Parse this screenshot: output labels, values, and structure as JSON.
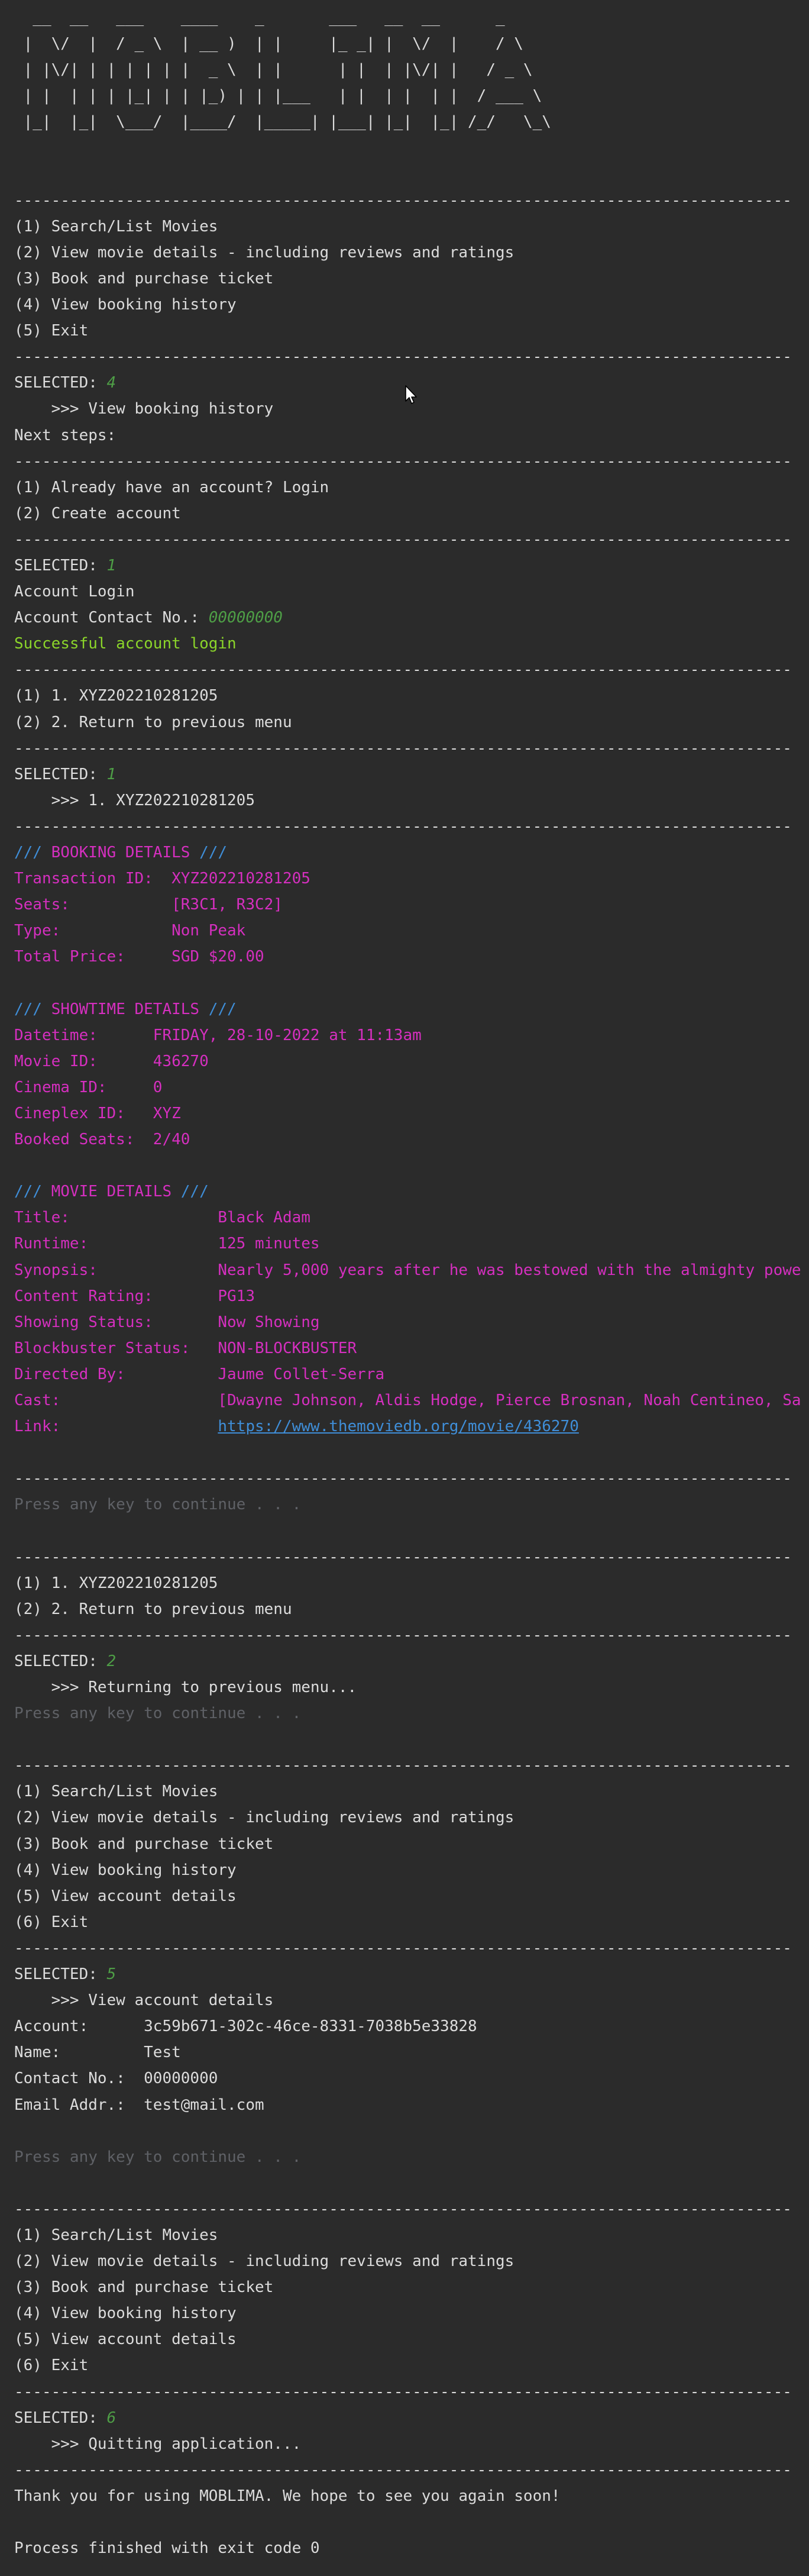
{
  "app": {
    "name": "MOBLIMA",
    "banner": [
      "  __  __   ___    ____    _       ___   __  __      _",
      " |  \\/  |  / _ \\  | __ )  | |     |_ _| |  \\/  |    / \\",
      " | |\\/| | | | | | |  _ \\  | |      | |  | |\\/| |   / _ \\",
      " | |  | | | |_| | | |_) | | |___   | |  | |  | |  / ___ \\",
      " |_|  |_|  \\___/  |____/  |_____| |___| |_|  |_| /_/   \\_\\"
    ]
  },
  "separator": "------------------------------------------------------------------------------------",
  "session": {
    "main_menu_1": [
      "(1) Search/List Movies",
      "(2) View movie details - including reviews and ratings",
      "(3) Book and purchase ticket",
      "(4) View booking history",
      "(5) Exit"
    ],
    "selected_label": "SELECTED: ",
    "selected_1": "4",
    "action_1": "    >>> View booking history",
    "next_steps": "Next steps:",
    "login_menu": [
      "(1) Already have an account? Login",
      "(2) Create account"
    ],
    "selected_2": "1",
    "account_login": "Account Login",
    "contact_prompt": "Account Contact No.: ",
    "contact_input": "00000000",
    "login_success": "Successful account login",
    "history_menu": [
      "(1) 1. XYZ202210281205",
      "(2) 2. Return to previous menu"
    ],
    "selected_3": "1",
    "action_3": "    >>> 1. XYZ202210281205",
    "booking": {
      "header_slashes_left": "///",
      "header_title": " BOOKING DETAILS ",
      "header_slashes_right": "///",
      "rows": [
        "Transaction ID:  XYZ202210281205",
        "Seats:           [R3C1, R3C2]",
        "Type:            Non Peak",
        "Total Price:     SGD $20.00"
      ]
    },
    "showtime": {
      "header_slashes_left": "///",
      "header_title": " SHOWTIME DETAILS ",
      "header_slashes_right": "///",
      "rows": [
        "Datetime:      FRIDAY, 28-10-2022 at 11:13am",
        "Movie ID:      436270",
        "Cinema ID:     0",
        "Cineplex ID:   XYZ",
        "Booked Seats:  2/40"
      ]
    },
    "movie": {
      "header_slashes_left": "///",
      "header_title": " MOVIE DETAILS ",
      "header_slashes_right": "///",
      "rows": [
        "Title:                Black Adam",
        "Runtime:              125 minutes",
        "Synopsis:             Nearly 5,000 years after he was bestowed with the almighty powe",
        "Content Rating:       PG13",
        "Showing Status:       Now Showing",
        "Blockbuster Status:   NON-BLOCKBUSTER",
        "Directed By:          Jaume Collet-Serra",
        "Cast:                 [Dwayne Johnson, Aldis Hodge, Pierce Brosnan, Noah Centineo, Sa"
      ],
      "link_label": "Link:                 ",
      "link_url": "https://www.themoviedb.org/movie/436270"
    },
    "press_any_key": "Press any key to continue . . .",
    "selected_4": "2",
    "action_4": "    >>> Returning to previous menu...",
    "main_menu_2": [
      "(1) Search/List Movies",
      "(2) View movie details - including reviews and ratings",
      "(3) Book and purchase ticket",
      "(4) View booking history",
      "(5) View account details",
      "(6) Exit"
    ],
    "selected_5": "5",
    "action_5": "    >>> View account details",
    "account": [
      "Account:      3c59b671-302c-46ce-8331-7038b5e33828",
      "Name:         Test",
      "Contact No.:  00000000",
      "Email Addr.:  test@mail.com"
    ],
    "selected_6": "6",
    "action_6": "    >>> Quitting application...",
    "goodbye": "Thank you for using MOBLIMA. We hope to see you again soon!",
    "exit_message": "Process finished with exit code 0"
  },
  "colors": {
    "background": "#2b2b2b",
    "text": "#dcdcdc",
    "selection_value": "#4e9e46",
    "success": "#8bd52a",
    "details": "#d52fbf",
    "header_slashes": "#3f8ed8",
    "muted": "#5f6166"
  }
}
